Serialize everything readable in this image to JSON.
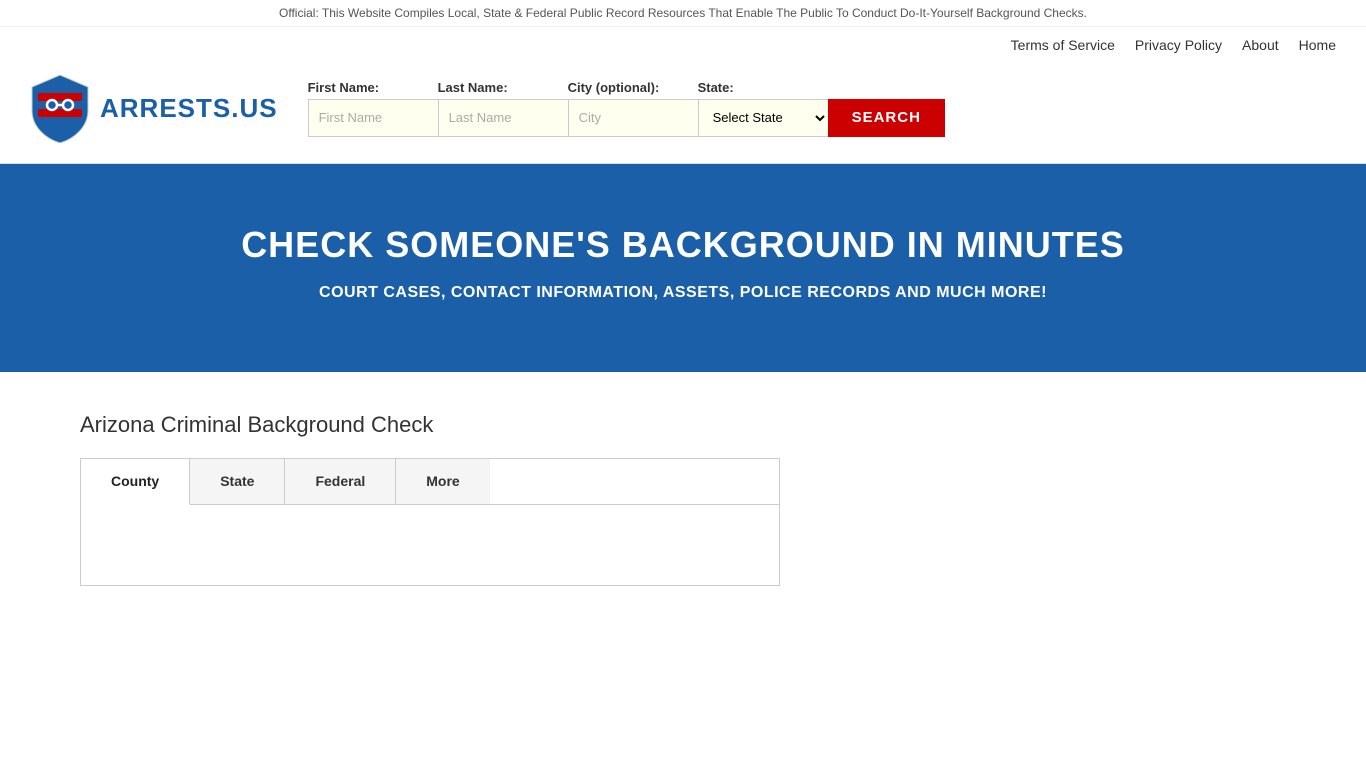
{
  "topbar": {
    "text": "Official: This Website Compiles Local, State & Federal Public Record Resources That Enable The Public To Conduct Do-It-Yourself Background Checks."
  },
  "nav": {
    "links": [
      {
        "label": "Terms of Service",
        "href": "#"
      },
      {
        "label": "Privacy Policy",
        "href": "#"
      },
      {
        "label": "About",
        "href": "#"
      },
      {
        "label": "Home",
        "href": "#"
      }
    ]
  },
  "logo": {
    "text": "ARRESTS.US"
  },
  "search": {
    "first_name_label": "First Name:",
    "last_name_label": "Last Name:",
    "city_label": "City (optional):",
    "state_label": "State:",
    "first_name_placeholder": "First Name",
    "last_name_placeholder": "Last Name",
    "city_placeholder": "City",
    "state_placeholder": "Select State",
    "button_label": "SEARCH"
  },
  "hero": {
    "heading": "CHECK SOMEONE'S BACKGROUND IN MINUTES",
    "subheading": "COURT CASES, CONTACT INFORMATION, ASSETS, POLICE RECORDS AND MUCH MORE!"
  },
  "main": {
    "section_title": "Arizona Criminal Background Check",
    "tabs": [
      {
        "label": "County",
        "active": true
      },
      {
        "label": "State",
        "active": false
      },
      {
        "label": "Federal",
        "active": false
      },
      {
        "label": "More",
        "active": false
      }
    ]
  }
}
